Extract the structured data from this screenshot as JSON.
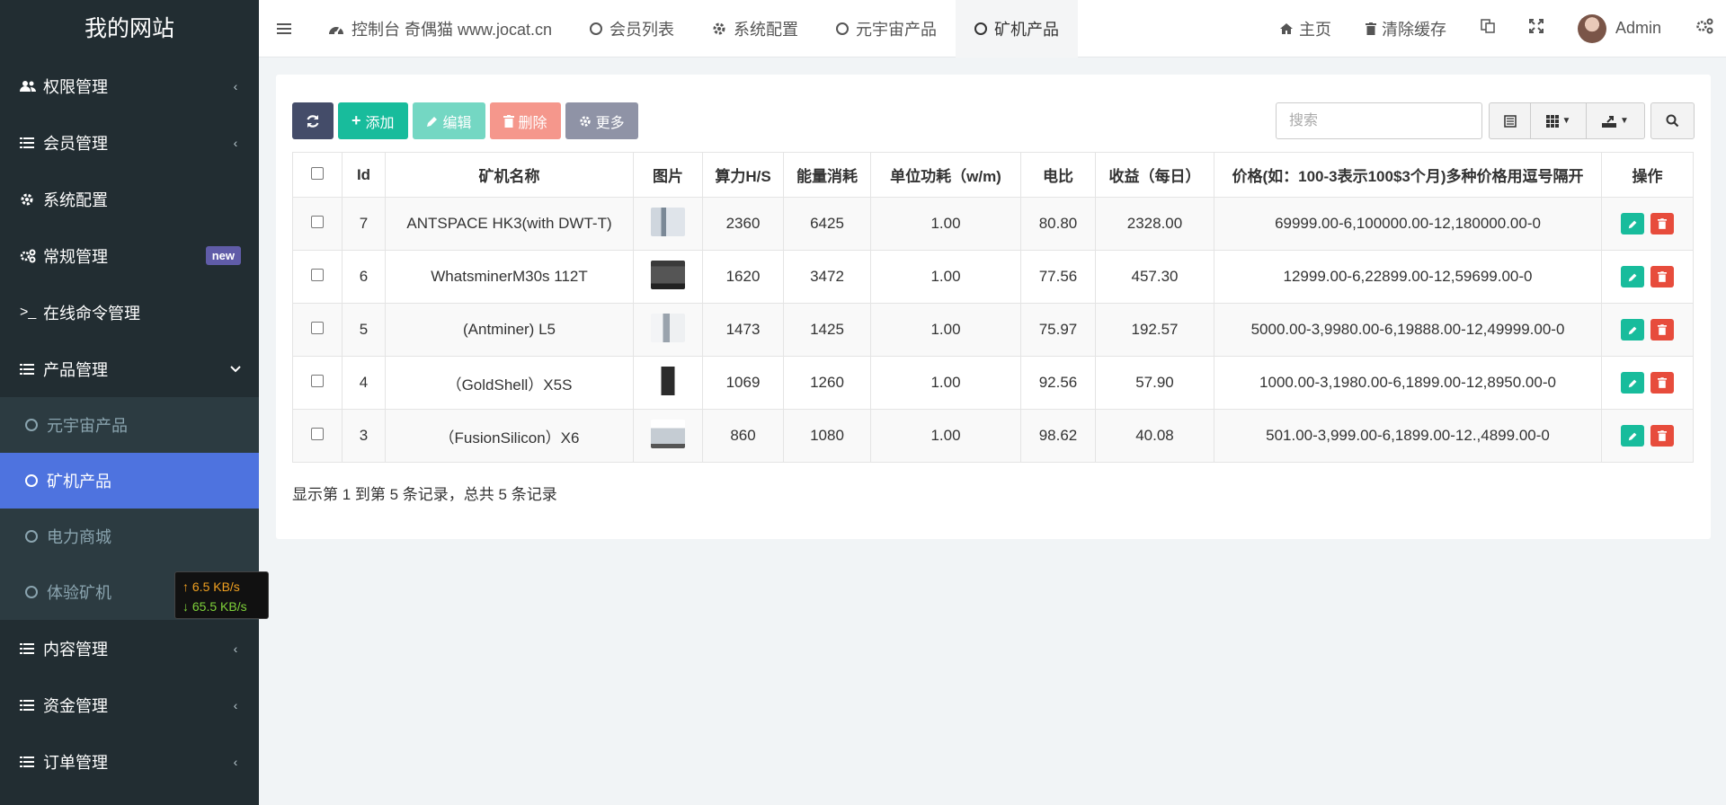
{
  "site_title": "我的网站",
  "sidebar": {
    "items": [
      {
        "label": "权限管理",
        "icon": "users-icon"
      },
      {
        "label": "会员管理",
        "icon": "list-icon"
      },
      {
        "label": "系统配置",
        "icon": "gear-icon"
      },
      {
        "label": "常规管理",
        "icon": "gears-icon",
        "badge": "new"
      },
      {
        "label": "在线命令管理",
        "icon": "terminal-icon"
      },
      {
        "label": "产品管理",
        "icon": "list-icon"
      }
    ],
    "sub_items": [
      {
        "label": "元宇宙产品"
      },
      {
        "label": "矿机产品"
      },
      {
        "label": "电力商城"
      },
      {
        "label": "体验矿机"
      }
    ],
    "bottom_items": [
      {
        "label": "内容管理"
      },
      {
        "label": "资金管理"
      },
      {
        "label": "订单管理"
      }
    ]
  },
  "netspeed": {
    "up": "↑ 6.5 KB/s",
    "down": "↓ 65.5 KB/s"
  },
  "header": {
    "tabs": [
      {
        "label": "控制台 奇偶猫 www.jocat.cn"
      },
      {
        "label": "会员列表"
      },
      {
        "label": "系统配置"
      },
      {
        "label": "元宇宙产品"
      },
      {
        "label": "矿机产品"
      }
    ],
    "home": "主页",
    "clear_cache": "清除缓存",
    "user": "Admin"
  },
  "toolbar": {
    "add": "添加",
    "edit": "编辑",
    "delete": "删除",
    "more": "更多",
    "search_placeholder": "搜索"
  },
  "table": {
    "columns": [
      "Id",
      "矿机名称",
      "图片",
      "算力H/S",
      "能量消耗",
      "单位功耗（w/m)",
      "电比",
      "收益（每日）",
      "价格(如：100-3表示100$3个月)多种价格用逗号隔开",
      "操作"
    ],
    "rows": [
      {
        "id": "7",
        "name": "ANTSPACE HK3(with DWT-T)",
        "hash": "2360",
        "energy": "6425",
        "unit": "1.00",
        "ratio": "80.80",
        "income": "2328.00",
        "price": "69999.00-6,100000.00-12,180000.00-0"
      },
      {
        "id": "6",
        "name": "WhatsminerM30s 112T",
        "hash": "1620",
        "energy": "3472",
        "unit": "1.00",
        "ratio": "77.56",
        "income": "457.30",
        "price": "12999.00-6,22899.00-12,59699.00-0"
      },
      {
        "id": "5",
        "name": "(Antminer) L5",
        "hash": "1473",
        "energy": "1425",
        "unit": "1.00",
        "ratio": "75.97",
        "income": "192.57",
        "price": "5000.00-3,9980.00-6,19888.00-12,49999.00-0"
      },
      {
        "id": "4",
        "name": "（GoldShell）X5S",
        "hash": "1069",
        "energy": "1260",
        "unit": "1.00",
        "ratio": "92.56",
        "income": "57.90",
        "price": "1000.00-3,1980.00-6,1899.00-12,8950.00-0"
      },
      {
        "id": "3",
        "name": "（FusionSilicon）X6",
        "hash": "860",
        "energy": "1080",
        "unit": "1.00",
        "ratio": "98.62",
        "income": "40.08",
        "price": "501.00-3,999.00-6,1899.00-12.,4899.00-0"
      }
    ]
  },
  "pagination_info": "显示第 1 到第 5 条记录，总共 5 条记录",
  "colors": {
    "sidebar_bg": "#222d32",
    "accent": "#4e73df",
    "success": "#18bc9c",
    "danger": "#e74c3c"
  }
}
